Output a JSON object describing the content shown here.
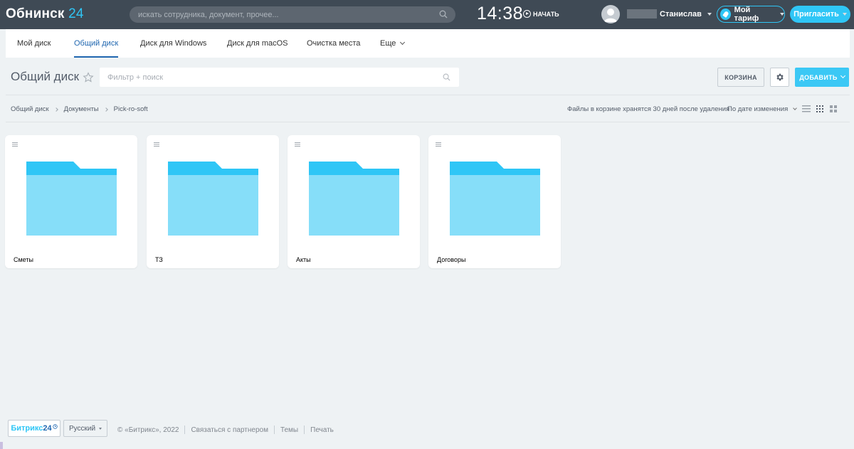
{
  "header": {
    "logo_text": "Обнинск",
    "logo_num": "24",
    "search_placeholder": "искать сотрудника, документ, прочее...",
    "clock": "14:38",
    "start_label": "НАЧАТЬ",
    "user_name": "Станислав",
    "tariff_label": "Мой тариф",
    "invite_label": "Пригласить"
  },
  "tabs": [
    {
      "label": "Мой диск"
    },
    {
      "label": "Общий диск"
    },
    {
      "label": "Диск для Windows"
    },
    {
      "label": "Диск для macOS"
    },
    {
      "label": "Очистка места"
    },
    {
      "label": "Еще"
    }
  ],
  "page": {
    "title": "Общий диск",
    "filter_placeholder": "Фильтр + поиск",
    "trash_label": "КОРЗИНА",
    "add_label": "ДОБАВИТЬ"
  },
  "breadcrumbs": [
    "Общий диск",
    "Документы",
    "Pick-ro-soft"
  ],
  "toolbar": {
    "note": "Файлы в корзине хранятся 30 дней после удаления",
    "sort_label": "По дате изменения"
  },
  "folders": [
    {
      "name": "Сметы"
    },
    {
      "name": "ТЗ"
    },
    {
      "name": "Акты"
    },
    {
      "name": "Договоры"
    }
  ],
  "footer": {
    "logo_text": "Битрикс",
    "logo_num": "24",
    "language": "Русский",
    "copyright": "© «Битрикс», 2022",
    "links": [
      "Связаться с партнером",
      "Темы",
      "Печать"
    ]
  },
  "colors": {
    "header_bg": "#3f4a55",
    "accent": "#2fc6f6",
    "folder_tab": "#2fc6f6",
    "folder_body": "#86def9",
    "page_bg": "#eef2f4",
    "active_tab": "#2067b0"
  }
}
